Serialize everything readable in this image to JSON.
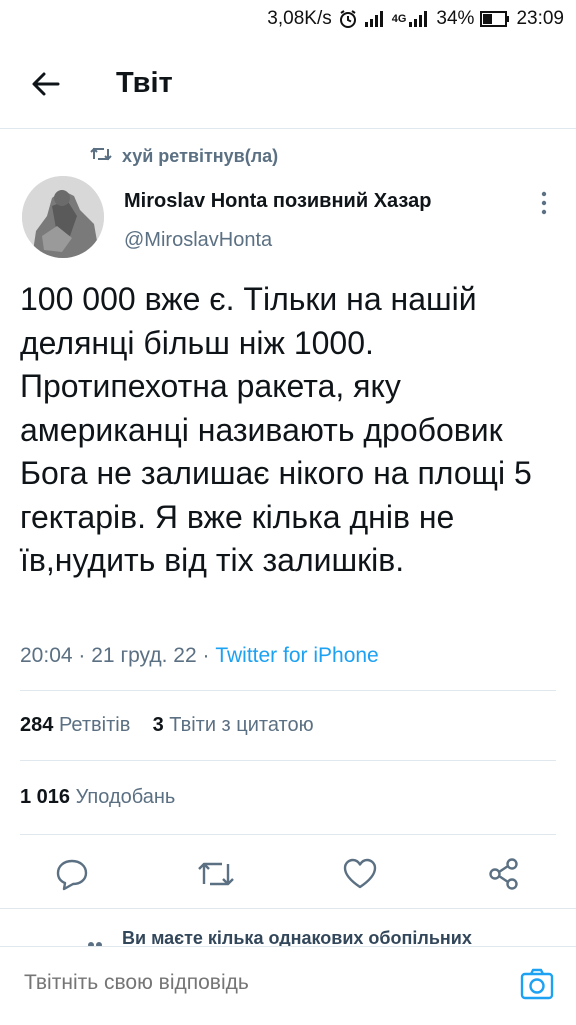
{
  "status_bar": {
    "net_speed": "3,08K/s",
    "network_type": "4G",
    "battery": "34%",
    "time": "23:09",
    "icons": [
      "alarm-icon",
      "signal-icon",
      "signal-icon",
      "battery-icon"
    ]
  },
  "header": {
    "title": "Твіт",
    "back_icon": "arrow-left-icon"
  },
  "tweet": {
    "retweeted_by": "хуй ретвітнув(ла)",
    "author_name": "Miroslav Honta позивний Хазар",
    "author_handle": "@MiroslavHonta",
    "text": "100 000 вже є. Тільки на нашій делянці більш ніж 1000. Протипехотна ракета, яку американці називають дробовик Бога не залишає нікого на площі 5 гектарів. Я вже кілька днів не їв,нудить від тіх залишків.",
    "time": "20:04",
    "date": "21 груд. 22",
    "client": "Twitter for iPhone",
    "separator": "·"
  },
  "stats": {
    "retweets_count": "284",
    "retweets_label": "Ретвітів",
    "quotes_count": "3",
    "quotes_label": "Твіти з цитатою",
    "likes_count": "1 016",
    "likes_label": "Уподобань"
  },
  "actions": [
    "reply-icon",
    "retweet-icon",
    "like-icon",
    "share-icon"
  ],
  "notice": "Ви маєте кілька однакових обопільних",
  "reply_bar": {
    "placeholder": "Твітніть свою відповідь",
    "camera_icon": "camera-icon"
  },
  "colors": {
    "accent": "#1da1f2",
    "secondary_text": "#5b7083",
    "divider": "#e1e8ed"
  }
}
